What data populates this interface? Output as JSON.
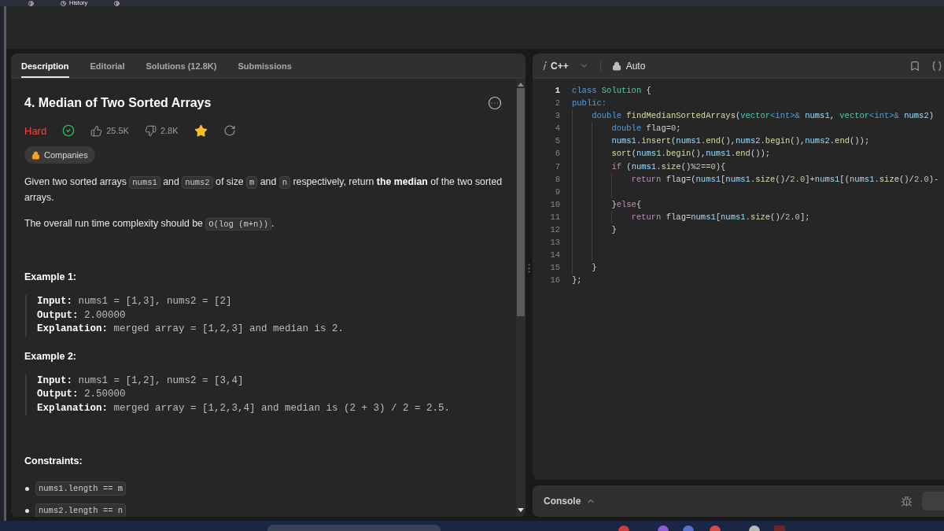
{
  "top_bar": {
    "history_label": "History"
  },
  "problem_panel": {
    "tabs": [
      {
        "label": "Description",
        "selected": true
      },
      {
        "label": "Editorial",
        "selected": false
      },
      {
        "label": "Solutions (12.8K)",
        "selected": false
      },
      {
        "label": "Submissions",
        "selected": false
      }
    ],
    "title": "4. Median of Two Sorted Arrays",
    "difficulty": {
      "label": "Hard",
      "kind": "hard"
    },
    "solved": true,
    "likes": "25.5K",
    "dislikes": "2.8K",
    "favorited": true,
    "companies": "Companies",
    "paragraphs": [
      [
        {
          "kind": "text",
          "text": "Given two sorted arrays "
        },
        {
          "kind": "code",
          "text": "nums1"
        },
        {
          "kind": "text",
          "text": " and "
        },
        {
          "kind": "code",
          "text": "nums2"
        },
        {
          "kind": "text",
          "text": " of size "
        },
        {
          "kind": "code",
          "text": "m"
        },
        {
          "kind": "text",
          "text": " and "
        },
        {
          "kind": "code",
          "text": "n"
        },
        {
          "kind": "text",
          "text": " respectively, return "
        },
        {
          "kind": "bold",
          "text": "the median"
        },
        {
          "kind": "text",
          "text": " of the two sorted arrays."
        }
      ],
      [
        {
          "kind": "text",
          "text": "The overall run time complexity should be "
        },
        {
          "kind": "code",
          "text": "O(log (m+n))"
        },
        {
          "kind": "text",
          "text": "."
        }
      ]
    ],
    "examples": [
      {
        "heading": "Example 1:",
        "lines": [
          {
            "label": "Input:",
            "value": "nums1 = [1,3], nums2 = [2]"
          },
          {
            "label": "Output:",
            "value": "2.00000"
          },
          {
            "label": "Explanation:",
            "value": "merged array = [1,2,3] and median is 2."
          }
        ]
      },
      {
        "heading": "Example 2:",
        "lines": [
          {
            "label": "Input:",
            "value": "nums1 = [1,2], nums2 = [3,4]"
          },
          {
            "label": "Output:",
            "value": "2.50000"
          },
          {
            "label": "Explanation:",
            "value": "merged array = [1,2,3,4] and median is (2 + 3) / 2 = 2.5."
          }
        ]
      }
    ],
    "constraints": {
      "heading": "Constraints:",
      "items": [
        "nums1.length == m",
        "nums2.length == n"
      ]
    }
  },
  "editor": {
    "language": "C++",
    "mode": "Auto",
    "lines": [
      {
        "number": "1",
        "current": true,
        "tokens": [
          {
            "kind": "keyword",
            "text": "class "
          },
          {
            "kind": "type",
            "text": "Solution"
          },
          {
            "kind": "plain",
            "text": " {"
          }
        ]
      },
      {
        "number": "2",
        "current": false,
        "tokens": [
          {
            "kind": "keyword",
            "text": "public:"
          }
        ]
      },
      {
        "number": "3",
        "current": false,
        "tokens": [
          {
            "kind": "keyword",
            "text": "    double "
          },
          {
            "kind": "function",
            "text": "findMedianSortedArrays"
          },
          {
            "kind": "plain",
            "text": "("
          },
          {
            "kind": "type",
            "text": "vector"
          },
          {
            "kind": "keyword",
            "text": "<int>& "
          },
          {
            "kind": "variable",
            "text": "nums1"
          },
          {
            "kind": "plain",
            "text": ", "
          },
          {
            "kind": "type",
            "text": "vector"
          },
          {
            "kind": "keyword",
            "text": "<int>& "
          },
          {
            "kind": "variable",
            "text": "nums2"
          },
          {
            "kind": "plain",
            "text": ")"
          }
        ]
      },
      {
        "number": "4",
        "current": false,
        "tokens": [
          {
            "kind": "keyword",
            "text": "        double"
          },
          {
            "kind": "plain",
            "text": " flag="
          },
          {
            "kind": "number",
            "text": "0"
          },
          {
            "kind": "plain",
            "text": ";"
          }
        ]
      },
      {
        "number": "5",
        "current": false,
        "tokens": [
          {
            "kind": "variable",
            "text": "        nums1"
          },
          {
            "kind": "plain",
            "text": "."
          },
          {
            "kind": "function",
            "text": "insert"
          },
          {
            "kind": "plain",
            "text": "("
          },
          {
            "kind": "variable",
            "text": "nums1"
          },
          {
            "kind": "plain",
            "text": "."
          },
          {
            "kind": "function",
            "text": "end"
          },
          {
            "kind": "plain",
            "text": "(),"
          },
          {
            "kind": "variable",
            "text": "nums2"
          },
          {
            "kind": "plain",
            "text": "."
          },
          {
            "kind": "function",
            "text": "begin"
          },
          {
            "kind": "plain",
            "text": "(),"
          },
          {
            "kind": "variable",
            "text": "nums2"
          },
          {
            "kind": "plain",
            "text": "."
          },
          {
            "kind": "function",
            "text": "end"
          },
          {
            "kind": "plain",
            "text": "());"
          }
        ]
      },
      {
        "number": "6",
        "current": false,
        "tokens": [
          {
            "kind": "function",
            "text": "        sort"
          },
          {
            "kind": "plain",
            "text": "("
          },
          {
            "kind": "variable",
            "text": "nums1"
          },
          {
            "kind": "plain",
            "text": "."
          },
          {
            "kind": "function",
            "text": "begin"
          },
          {
            "kind": "plain",
            "text": "(),"
          },
          {
            "kind": "variable",
            "text": "nums1"
          },
          {
            "kind": "plain",
            "text": "."
          },
          {
            "kind": "function",
            "text": "end"
          },
          {
            "kind": "plain",
            "text": "());"
          }
        ]
      },
      {
        "number": "7",
        "current": false,
        "tokens": [
          {
            "kind": "control",
            "text": "        if"
          },
          {
            "kind": "plain",
            "text": " ("
          },
          {
            "kind": "variable",
            "text": "nums1"
          },
          {
            "kind": "plain",
            "text": "."
          },
          {
            "kind": "function",
            "text": "size"
          },
          {
            "kind": "plain",
            "text": "()%"
          },
          {
            "kind": "number",
            "text": "2"
          },
          {
            "kind": "plain",
            "text": "=="
          },
          {
            "kind": "number",
            "text": "0"
          },
          {
            "kind": "plain",
            "text": "){"
          }
        ]
      },
      {
        "number": "8",
        "current": false,
        "tokens": [
          {
            "kind": "control",
            "text": "            return"
          },
          {
            "kind": "plain",
            "text": " flag=("
          },
          {
            "kind": "variable",
            "text": "nums1"
          },
          {
            "kind": "plain",
            "text": "["
          },
          {
            "kind": "variable",
            "text": "nums1"
          },
          {
            "kind": "plain",
            "text": "."
          },
          {
            "kind": "function",
            "text": "size"
          },
          {
            "kind": "plain",
            "text": "()/"
          },
          {
            "kind": "number",
            "text": "2.0"
          },
          {
            "kind": "plain",
            "text": "]+"
          },
          {
            "kind": "variable",
            "text": "nums1"
          },
          {
            "kind": "plain",
            "text": "[("
          },
          {
            "kind": "variable",
            "text": "nums1"
          },
          {
            "kind": "plain",
            "text": "."
          },
          {
            "kind": "function",
            "text": "size"
          },
          {
            "kind": "plain",
            "text": "()/"
          },
          {
            "kind": "number",
            "text": "2.0"
          },
          {
            "kind": "plain",
            "text": ")-"
          }
        ]
      },
      {
        "number": "9",
        "current": false
      },
      {
        "number": "10",
        "current": false,
        "tokens": [
          {
            "kind": "plain",
            "text": "        }"
          },
          {
            "kind": "control",
            "text": "else"
          },
          {
            "kind": "plain",
            "text": "{"
          }
        ]
      },
      {
        "number": "11",
        "current": false,
        "tokens": [
          {
            "kind": "control",
            "text": "            return"
          },
          {
            "kind": "plain",
            "text": " flag="
          },
          {
            "kind": "variable",
            "text": "nums1"
          },
          {
            "kind": "plain",
            "text": "["
          },
          {
            "kind": "variable",
            "text": "nums1"
          },
          {
            "kind": "plain",
            "text": "."
          },
          {
            "kind": "function",
            "text": "size"
          },
          {
            "kind": "plain",
            "text": "()/"
          },
          {
            "kind": "number",
            "text": "2.0"
          },
          {
            "kind": "plain",
            "text": "];"
          }
        ]
      },
      {
        "number": "12",
        "current": false,
        "tokens": [
          {
            "kind": "plain",
            "text": "        }"
          }
        ]
      },
      {
        "number": "13",
        "current": false
      },
      {
        "number": "14",
        "current": false
      },
      {
        "number": "15",
        "current": false,
        "tokens": [
          {
            "kind": "plain",
            "text": "    }"
          }
        ]
      },
      {
        "number": "16",
        "current": false,
        "tokens": [
          {
            "kind": "plain",
            "text": "};"
          }
        ]
      }
    ]
  },
  "console": {
    "label": "Console"
  }
}
